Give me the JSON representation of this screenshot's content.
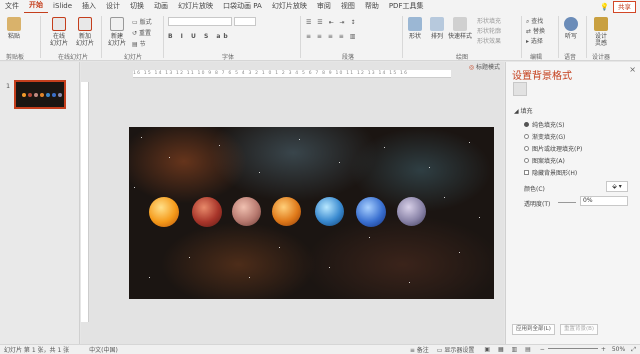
{
  "tabs": [
    "文件",
    "开始",
    "iSlide",
    "插入",
    "设计",
    "切换",
    "动画",
    "幻灯片放映",
    "口袋动画 PA",
    "幻灯片放映",
    "审阅",
    "视图",
    "帮助",
    "PDF工具集"
  ],
  "active_tab": "开始",
  "search_hint": "操作说明搜索",
  "share_label": "共享",
  "ribbon": {
    "paste": "粘贴",
    "clipboard_group": "剪贴板",
    "online_ppt": "在线\n幻灯片",
    "new_slide_online": "新加\n幻灯片",
    "online_group": "在线幻灯片",
    "new_slide": "新建\n幻灯片",
    "layout": "版式",
    "reset": "重置",
    "section": "节",
    "slides_group": "幻灯片",
    "font_group": "字体",
    "paragraph_group": "段落",
    "shape": "形状",
    "arrange": "排列",
    "quick_styles": "快速样式",
    "shape_fill": "形状填充",
    "shape_outline": "形状轮廓",
    "shape_effect": "形状效果",
    "drawing_group": "绘图",
    "find": "查找",
    "replace": "替换",
    "select": "选择",
    "editing_group": "编辑",
    "dictate": "听写",
    "voice_group": "语音",
    "design_ideas": "设计\n灵感",
    "designer_group": "设计器"
  },
  "thumb_panel": {
    "slide_number": "1"
  },
  "canvas": {
    "ruler_labels": "16 15 14 13 12 11 10 9 8 7 6 5 4 3 2 1 0 1 2 3 4 5 6 7 8 9 10 11 12 13 14 15 16",
    "slide_mode": "标题模式"
  },
  "pane": {
    "title": "设置背景格式",
    "close": "×",
    "fill_section": "◢ 填充",
    "options": [
      {
        "label": "纯色填充(S)",
        "type": "radio",
        "selected": true
      },
      {
        "label": "渐变填充(G)",
        "type": "radio",
        "selected": false
      },
      {
        "label": "图片或纹理填充(P)",
        "type": "radio",
        "selected": false
      },
      {
        "label": "图案填充(A)",
        "type": "radio",
        "selected": false
      },
      {
        "label": "隐藏背景图形(H)",
        "type": "check",
        "selected": false
      }
    ],
    "color_label": "颜色(C)",
    "transparency_label": "透明度(T)",
    "transparency_value": "0%",
    "apply_all": "应用到全部(L)",
    "reset_bg": "重置背景(B)"
  },
  "status": {
    "slide_info": "幻灯片 第 1 张，共 1 张",
    "language": "中文(中国)",
    "notes": "备注",
    "display": "显示器设置",
    "zoom": "50%"
  },
  "colors": {
    "accent": "#c43e1c"
  }
}
